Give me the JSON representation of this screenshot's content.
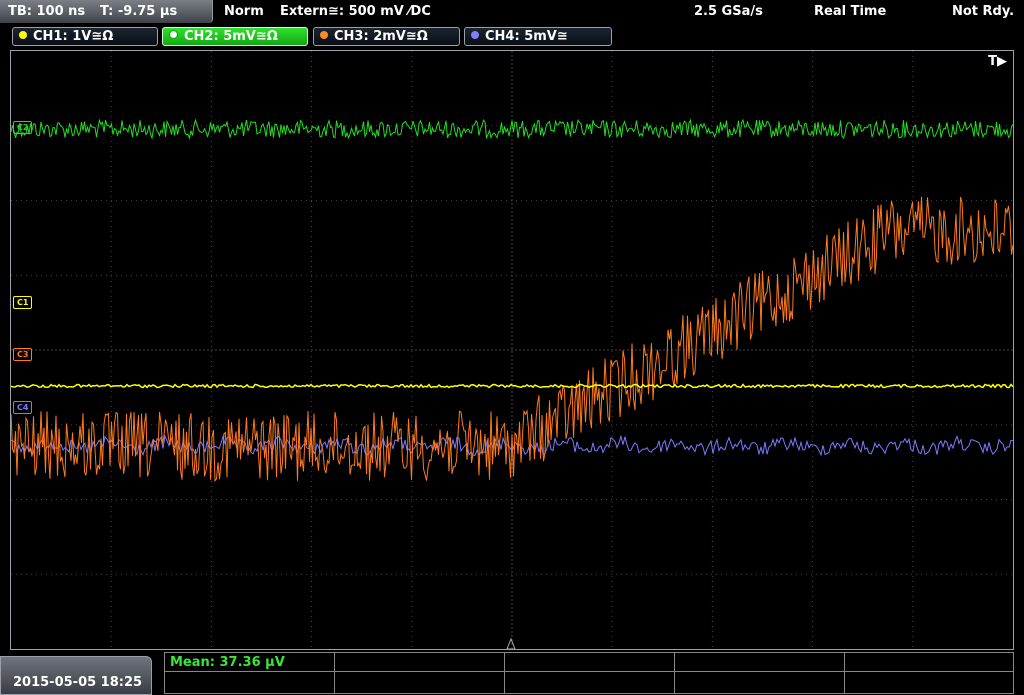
{
  "topbar": {
    "timebase": "TB: 100 ns",
    "trigger_offset": "T: -9.75 µs",
    "acq_mode": "Norm",
    "trigger": "Extern≅: 500 mV ⁄DC",
    "sample_rate": "2.5 GSa/s",
    "realtime": "Real Time",
    "status": "Not Rdy."
  },
  "channels": [
    {
      "label": "CH1: 1V≅Ω",
      "color": "#ffff00"
    },
    {
      "label": "CH2: 5mV≅Ω",
      "color": "#33dd33"
    },
    {
      "label": "CH3: 2mV≅Ω",
      "color": "#ff8a2a"
    },
    {
      "label": "CH4: 5mV≅",
      "color": "#8080ff"
    }
  ],
  "screen": {
    "trigger_pos_label": "T▶",
    "markers": {
      "ch2": "C2",
      "ch1": "C1",
      "ch3": "C3",
      "ch4": "C4"
    }
  },
  "footer": {
    "datetime": "2015-05-05 18:25",
    "measurement": "Mean: 37.36 µV"
  },
  "colors": {
    "ch1": "#ffff00",
    "ch2": "#22dd22",
    "ch3": "#ff7a1a",
    "ch4": "#7a7aff",
    "grid": "#444444"
  }
}
